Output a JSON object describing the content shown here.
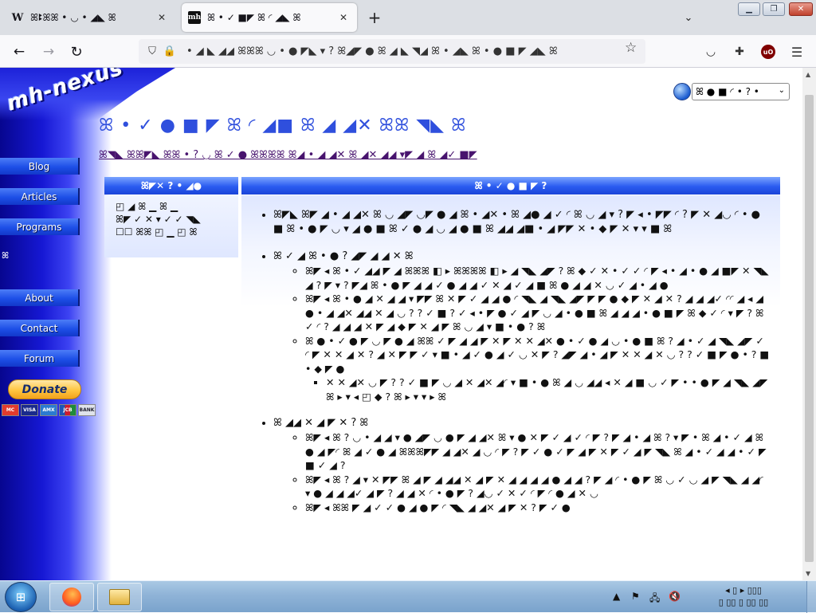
{
  "browser": {
    "tabs": [
      {
        "favicon": "W",
        "title": "ꕤꔪꕤꕤ • ◡ • ◢◣ ꕤ",
        "active": false
      },
      {
        "favicon": "mh",
        "title": "ꕤ • ✓ ■◤ ꕤ ◜ ◢◣ ꕤ",
        "active": true
      }
    ],
    "new_tab": "+",
    "tab_list": "⌄",
    "url": "• ◢ ◣ ◢◢ ꕤꕤꕤ ◡ • ● ◤◣ ▾ ? ꕤ◢◤ ● ꕤ ◢ ◣ ◥◢ ꕤ • ◢◣ ꕤ • ● ■ ◤ ◢◣ ꕤ"
  },
  "site": {
    "logo": "mh-nexus",
    "nav_top": [
      "Blog",
      "Articles",
      "Programs"
    ],
    "nav_bottom": [
      "About",
      "Contact",
      "Forum"
    ],
    "side_glyph": "ꕤ",
    "donate": "Donate",
    "cards": [
      "MC",
      "VISA",
      "AMX",
      "JCB",
      "BANK"
    ],
    "language": "ꕤ ● ■ ◜ • ? •",
    "title": "ꕤ • ✓ ● ■ ◤ ꕤ ◜ ◢■ ꕤ ◢ ◢✕ ꕤꕤ ◥◣ ꕤ",
    "subtitle": "ꕤ◥◣ ꕤꕤ◤◣ ꕤꕤ • ? ◡ ꕤ ✓ ● ꕤꕤꕤꕤ ꕤ◢ • ◢ ◢✕ ꕤ ◢✕ ◢◢ ▾◤ ◢ ꕤ ◢✓ ■◤"
  },
  "table": {
    "left_header": "ꕤ◤✕ ? • ◢●",
    "right_header": "ꕤ • ✓ ● ■ ◤ ?",
    "left_items": [
      "◰ ◢ ꕤ ▁ ꕤ ▁",
      "ꕤ◤ ✓ ✕ ▾ ✓ ✓ ◥◣",
      "☐☐ ꕤꕤ ◰ ▁ ◰ ꕤ"
    ],
    "sections": [
      {
        "text": "ꕤ◤◣ ꕤ◤ ◢ • ◢ ◢✕ ꕤ ◡ ◢◤ ◡◤ ● ◢ ꕤ • ◢✕ • ꕤ ◢● ◢ ✓ ◜ ꕤ ◡ ◢ ▾ ? ◤ ◂ • ◤◤ ◜ ? ◤ ✕ ◢◡ ◜ • ● ■ ꕤ • ● ◤ ◡ ▾ ◢ ● ■ ꕤ ✓ ● ◢ ◡ ◢ ● ■ ꕤ ◢◢ ◢■ • ◢ ◤◤ ✕ • ◆ ◤ ✕ ▾ ▾ ■ ꕤ",
        "subs": []
      },
      {
        "text": "ꕤ ✓ ◢ ꕤ • ● ? ◢◤ ◢ ◢ ✕ ꕤ",
        "subs": [
          {
            "text": "ꕤ◤ ◂ ꕤ • ✓ ◢◢ ◤ ◢ ꕤꕤꕤ ◧ ▸ ꕤꕤꕤꕤ ◧ ▸ ◢ ◥◣ ◢◤ ? ꕤ ◆ ✓ ✕ • ✓ ✓ ◜ ◤ ◂ • ◢ • ● ◢ ■◤ ✕ ◥◣ ◢ ? ◤ ▾ ? ◤◢ ꕤ • ● ◤ ◢ ◢ ✓ ● ◢ ◢ ✓ ✕ ◢ ✓ ◢ ■ ꕤ ● ◢ ◢ ✕ ◡ ✓ ◢ • ◢ ●",
            "subs": []
          },
          {
            "text": "ꕤ◤ ◂ ꕤ • ● ◢ ✕ ◢ ◢ ▾ ◤◤ ꕤ ✕ ◤ ✓ ◢ ◢ ● ◜ ◥◣ ◢ ◥◣ ◢◤ ◤ ◤ ● ◆ ◤ ✕ ◢ ✕ ? ◢ ◢ ◢✓ ◜◜ ◢ ◂ ◢ ● • ◢ ◢✕ ◢◢ ✕ ◢ ◡ ? ? ✓ ■ ? ✓ ◂ • ◤ ● ✓ ◢ ◤ ◡ ◢ • ● ■ ꕤ ◢ ◢ ◢ • ● ■ ◤ ꕤ ◆ ✓ ◜ ▾ ◤ ? ꕤ ✓ ◜ ? ◢ ◢ ◢ ✕ ◤ ◢ ◆ ◤ ✕ ◢ ◤ ꕤ ◡ ◢ ▾ ■ • ● ? ꕤ",
            "subs": []
          },
          {
            "text": "ꕤ ● • ✓ ● ◤ ◡ ◤ ● ◢ ꕤꕤ ✓ ◤ ◢ ◢ ◤ ✕ ◤ ✕ ✕ ◢✕ ● • ✓ ● ◢ ◡ • ● ■ ꕤ ? ◢ • ✓ ◢ ◥◣ ◢◤ ✓ ◜ ◤ ✕ ✕ ◢ ✕ ? ◢ ✕ ◤ ◤ ✓ ▾ ■ • ◢ ✓ ● ◢ ✓ ◡ ✕ ◤ ? ◢◤ ◢ • ◢ ◤ ✕ ✕ ◢ ✕ ◡ ? ? ✓ ■ ◤ ● • ? ■ • ◆ ◤ ●",
            "subs": [
              "✕ ✕ ◢✕ ◡ ◤ ? ? ✓ ■ ◤ ◡ ◢ ✕ ◢✕ ◢◜ ▾ ■ • ● ꕤ ◢ ◡ ◢◢ ◂ ✕ ◢ ■ ◡ ✓ ◤ • • ● ◤ ◢ ◥◣ ◢◤ ꕤ ▸ ▾ ◂ ◰ ◆ ? ꕤ ▸ ▾ ▾ ▸ ꕤ"
            ]
          }
        ]
      },
      {
        "text": "ꕤ ◢◢ ✕ ◢ ◤ ✕ ? ꕤ",
        "subs": [
          {
            "text": "ꕤ◤ ◂ ꕤ ? ◡ • ◢ ◢ ▾ ● ◢◤ ◡ ● ◤ ◢ ◢✕ ꕤ ▾ ● ✕ ◤ ✓ ◢ ✓ ◜ ◤ ? ◤ ◢ • ◢ ꕤ ? ▾ ◤ • ꕤ ◢ • ✓ ◢ ꕤ ● ◢ ◤◜ ꕤ ◢ ✓ ● ◢ ꕤꕤꕤ◤◤ ◢ ◢✕ ◢ ◡ ◜ ◤ ? ◤ ✓ ● ✓ ◤ ◢ ◤ ✕ ◤ ✓ ◢ ◤ ◥◣ ꕤ ◢ • ✓ ◢ ◢ • ✓ ◤ ■ ✓ ◢ ?",
            "subs": []
          },
          {
            "text": "ꕤ◤ ◂ ꕤ ? ◢ ▾ ✕ ◤◤ ꕤ ◢ ◤ ◢ ◢◢ ✕ ◢ ◤ ✕ ◢ ◢ ◢ ◢ ● ◢ ◢ ? ◤ ◢ ◜ • ● ◤ ꕤ ◡ ✓ ◡ ◢ ◤ ◥◣ ◢ ◢◜ ▾ ● ◢ ◢ ◢✓ ◢ ◤ ? ◢ ◢ ✕ ◜ • ● ◤ ? ◢◡ ✓ ✕ ✓ ◜ ◤ ◜ ● ◢ ✕ ◡",
            "subs": []
          },
          {
            "text": "ꕤ◤ ◂ ꕤꕤ ◤ ◢ ✓ ✓ ● ◢ ● ◤ ◜ ◥◣ ◢ ◢✕ ◢ ◤ ✕ ? ◤ ✓ ●",
            "subs": []
          }
        ]
      }
    ]
  },
  "taskbar": {
    "start": "⊞",
    "tray_arrow": "▲",
    "tray_flag": "⚑",
    "tray_network": "🖧",
    "tray_volume": "🔇",
    "clock_line1": "◂ ▯ ▸ ▯▯▯",
    "clock_line2": "▯ ▯▯ ▯ ▯▯ ▯▯"
  }
}
